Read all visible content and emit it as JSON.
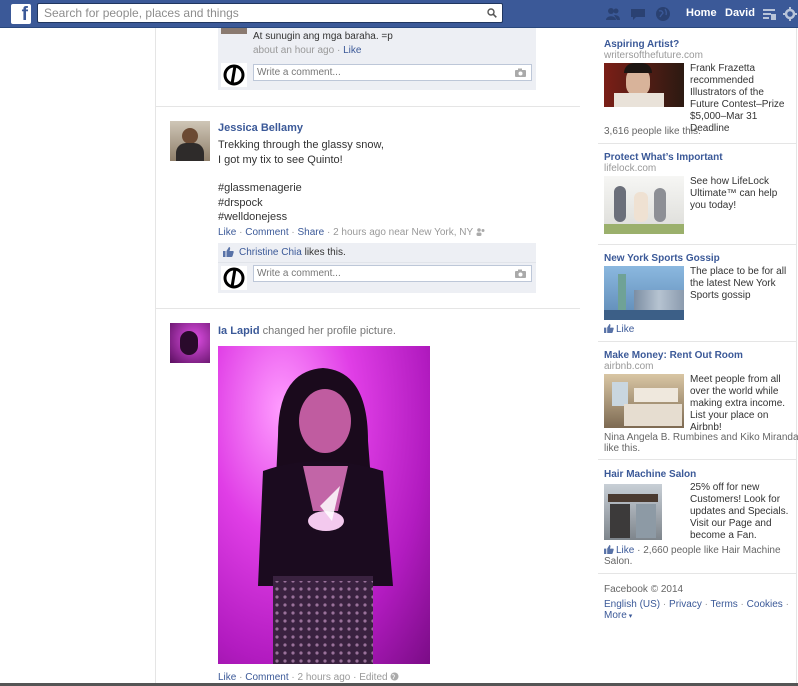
{
  "topbar": {
    "logo": "f",
    "search_placeholder": "Search for people, places and things",
    "nav_home": "Home",
    "nav_user": "David"
  },
  "feed": {
    "prev_post": {
      "comment_text": "At sunugin ang mga baraha. =p",
      "time": "about an hour ago",
      "like": "Like",
      "comment_placeholder": "Write a comment..."
    },
    "post1": {
      "author": "Jessica Bellamy",
      "line1": "Trekking through the glassy snow,",
      "line2": "I got my tix to see Quinto!",
      "tag1": "#glassmenagerie",
      "tag2": "#drspock",
      "tag3": "#welldonejess",
      "like": "Like",
      "comment": "Comment",
      "share": "Share",
      "time": "2 hours ago near New York, NY",
      "liker": "Christine Chia",
      "likes_this": "likes this.",
      "comment_placeholder": "Write a comment..."
    },
    "post2": {
      "author": "Ia Lapid",
      "action": "changed her profile picture.",
      "like": "Like",
      "comment": "Comment",
      "time": "2 hours ago",
      "edited": "Edited"
    }
  },
  "sidebar": {
    "ads": [
      {
        "title": "Aspiring Artist?",
        "domain": "writersofthefuture.com",
        "body": "Frank Frazetta recommended Illustrators of the Future Contest–Prize $5,000–Mar 31 Deadline",
        "social": "3,616 people like this."
      },
      {
        "title": "Protect What’s Important",
        "domain": "lifelock.com",
        "body": "See how LifeLock Ultimate™ can help you today!"
      },
      {
        "title": "New York Sports Gossip",
        "body": "The place to be for all the latest New York Sports gossip",
        "like": "Like"
      },
      {
        "title": "Make Money: Rent Out Room",
        "domain": "airbnb.com",
        "body": "Meet people from all over the world while making extra income. List your place on Airbnb!",
        "social_line1": "Nina Angela B. Rumbines and Kiko Miranda",
        "social_line2": "like this."
      },
      {
        "title": "Hair Machine Salon",
        "body": "25% off for new Customers! Look for updates and Specials. Visit our Page and become a Fan.",
        "like": "Like",
        "social_line1": "2,660 people like Hair Machine",
        "social_line2": "Salon."
      }
    ],
    "footer": {
      "copyright": "Facebook © 2014",
      "lang": "English (US)",
      "privacy": "Privacy",
      "terms": "Terms",
      "cookies": "Cookies",
      "more": "More"
    }
  }
}
